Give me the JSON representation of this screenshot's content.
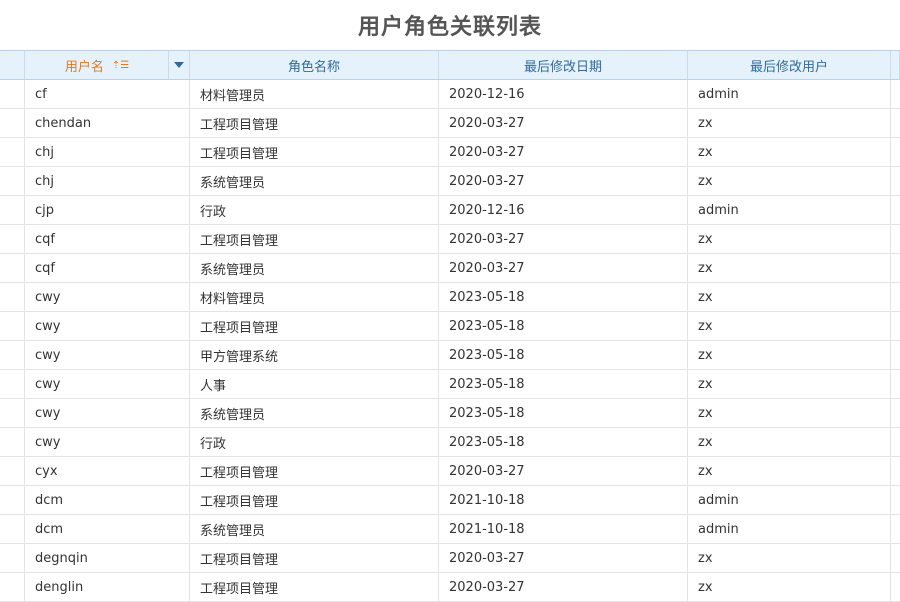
{
  "page": {
    "title": "用户角色关联列表"
  },
  "table": {
    "headers": [
      "用户名",
      "角色名称",
      "最后修改日期",
      "最后修改用户"
    ],
    "rows": [
      [
        "cf",
        "材料管理员",
        "2020-12-16",
        "admin"
      ],
      [
        "chendan",
        "工程项目管理",
        "2020-03-27",
        "zx"
      ],
      [
        "chj",
        "工程项目管理",
        "2020-03-27",
        "zx"
      ],
      [
        "chj",
        "系统管理员",
        "2020-03-27",
        "zx"
      ],
      [
        "cjp",
        "行政",
        "2020-12-16",
        "admin"
      ],
      [
        "cqf",
        "工程项目管理",
        "2020-03-27",
        "zx"
      ],
      [
        "cqf",
        "系统管理员",
        "2020-03-27",
        "zx"
      ],
      [
        "cwy",
        "材料管理员",
        "2023-05-18",
        "zx"
      ],
      [
        "cwy",
        "工程项目管理",
        "2023-05-18",
        "zx"
      ],
      [
        "cwy",
        "甲方管理系统",
        "2023-05-18",
        "zx"
      ],
      [
        "cwy",
        "人事",
        "2023-05-18",
        "zx"
      ],
      [
        "cwy",
        "系统管理员",
        "2023-05-18",
        "zx"
      ],
      [
        "cwy",
        "行政",
        "2023-05-18",
        "zx"
      ],
      [
        "cyx",
        "工程项目管理",
        "2020-03-27",
        "zx"
      ],
      [
        "dcm",
        "工程项目管理",
        "2021-10-18",
        "admin"
      ],
      [
        "dcm",
        "系统管理员",
        "2021-10-18",
        "admin"
      ],
      [
        "degnqin",
        "工程项目管理",
        "2020-03-27",
        "zx"
      ],
      [
        "denglin",
        "工程项目管理",
        "2020-03-27",
        "zx"
      ]
    ]
  },
  "icons": {
    "sort": "sort-ascending-icon",
    "dropdown": "chevron-down-icon"
  },
  "colors": {
    "header_bg": "#e6f2fb",
    "sorted_header_text": "#e07a1f",
    "header_text": "#2f6b9a",
    "title": "#555555"
  }
}
